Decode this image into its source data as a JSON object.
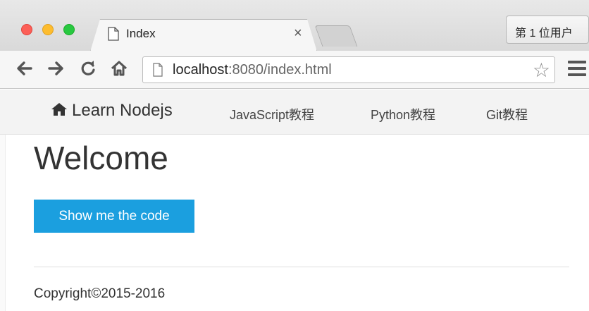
{
  "browser": {
    "tab": {
      "title": "Index",
      "close": "×"
    },
    "profile_button": "第 1 位用户",
    "address": {
      "host": "localhost",
      "rest": ":8080/index.html"
    },
    "icons": {
      "back": "arrow-left-icon",
      "forward": "arrow-right-icon",
      "reload": "reload-icon",
      "home": "home-icon",
      "star": "star-icon",
      "menu": "hamburger-menu-icon"
    }
  },
  "navbar": {
    "brand": "Learn Nodejs",
    "links": [
      "JavaScript教程",
      "Python教程",
      "Git教程"
    ]
  },
  "main": {
    "heading": "Welcome",
    "button": "Show me the code"
  },
  "footer": {
    "copyright": "Copyright©2015-2016"
  },
  "colors": {
    "button_bg": "#1b9fdf",
    "navbar_bg": "#f3f3f3",
    "traffic_red": "#fc5f57",
    "traffic_yellow": "#fdbc2e",
    "traffic_green": "#28c840"
  }
}
